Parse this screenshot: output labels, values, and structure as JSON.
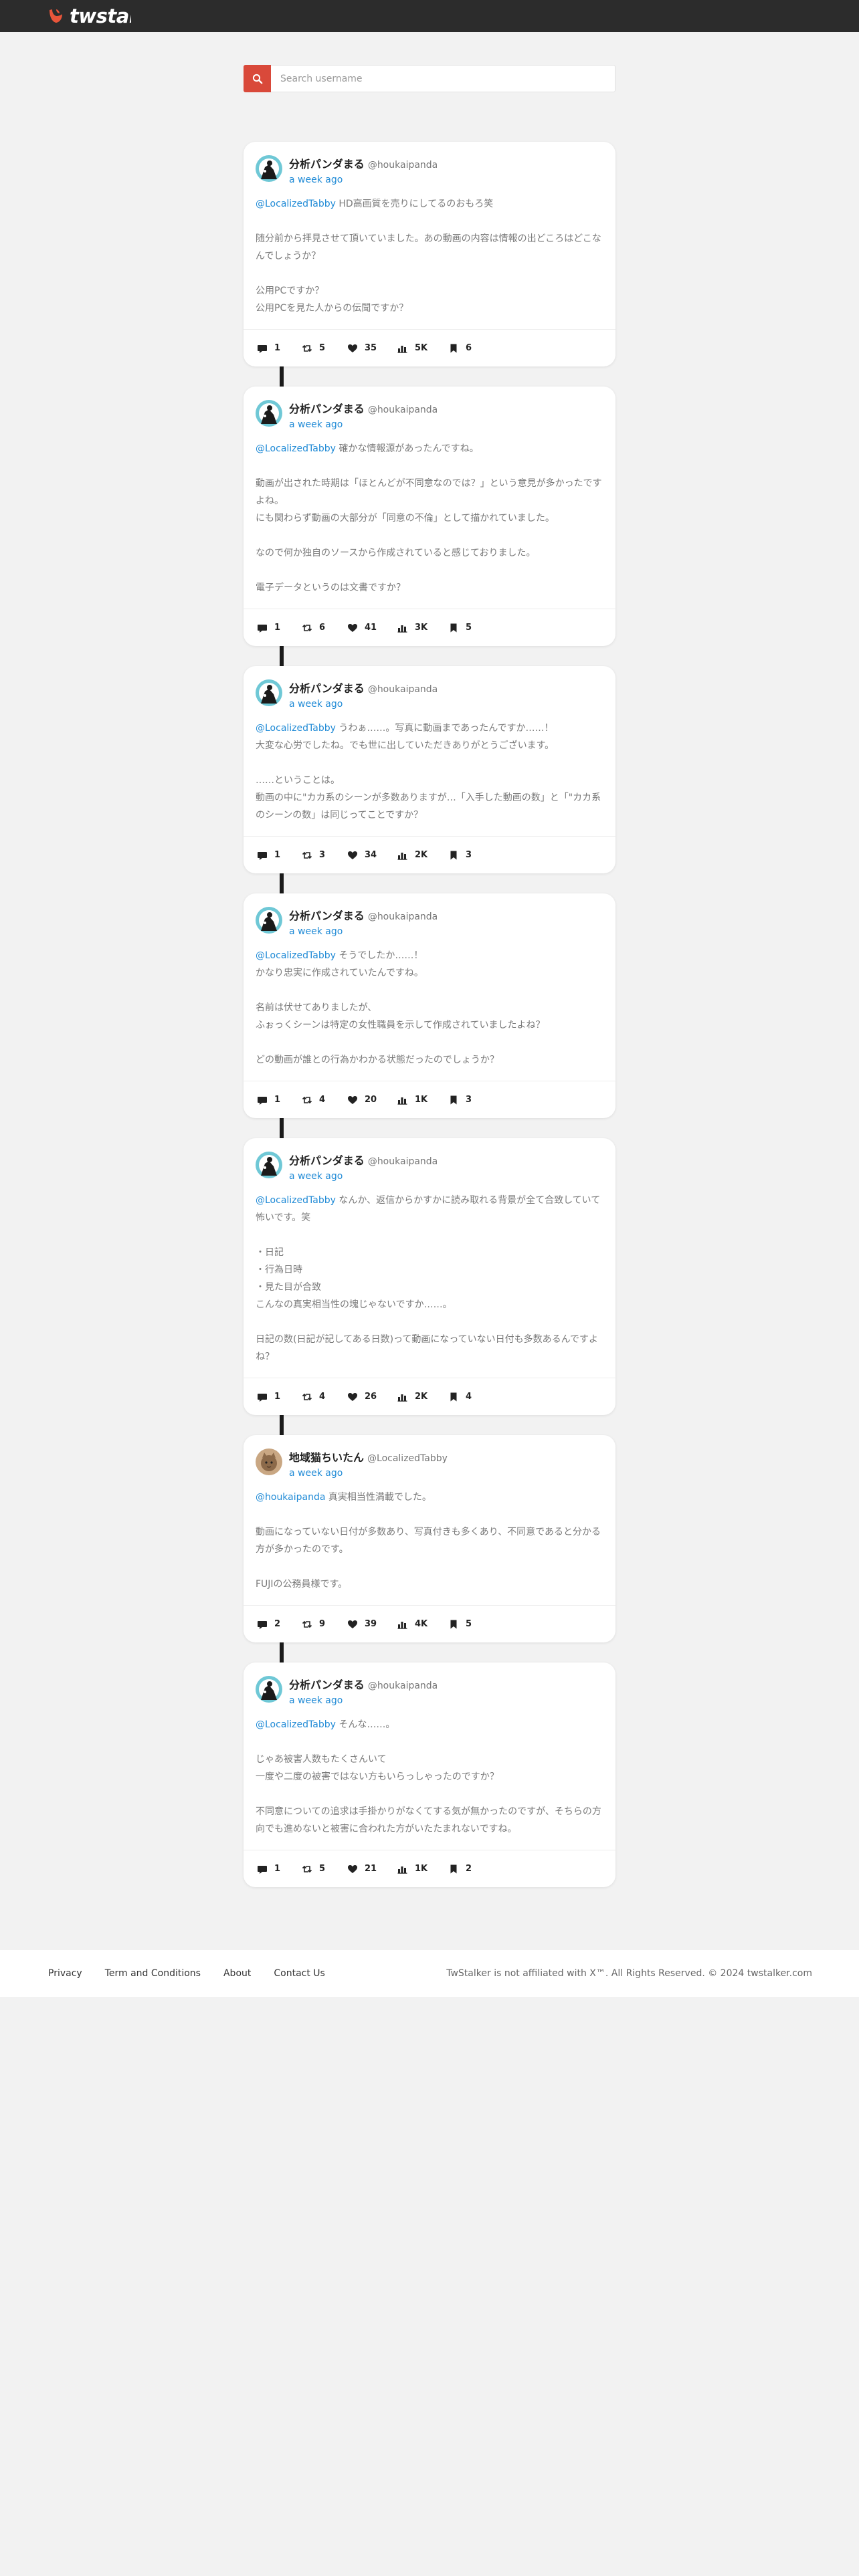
{
  "brand": {
    "name": "twstalker",
    "accent": "#e9553a"
  },
  "search": {
    "placeholder": "Search username",
    "value": ""
  },
  "posts": [
    {
      "avatar": "panda",
      "name": "分析パンダまる",
      "handle": "@houkaipanda",
      "time": "a week ago",
      "mention": "@LocalizedTabby",
      "text": " HD高画質を売りにしてるのおもろ笑\n\n随分前から拝見させて頂いていました。あの動画の内容は情報の出どころはどこなんでしょうか？\n\n公用PCですか？\n公用PCを見た人からの伝聞ですか？",
      "stats": {
        "replies": "1",
        "retweets": "5",
        "likes": "35",
        "views": "5K",
        "bookmarks": "6"
      }
    },
    {
      "avatar": "panda",
      "name": "分析パンダまる",
      "handle": "@houkaipanda",
      "time": "a week ago",
      "mention": "@LocalizedTabby",
      "text": " 確かな情報源があったんですね。\n\n動画が出された時期は「ほとんどが不同意なのでは？」という意見が多かったですよね。\nにも関わらず動画の大部分が「同意の不倫」として描かれていました。\n\nなので何か独自のソースから作成されていると感じておりました。\n\n電子データというのは文書ですか？",
      "stats": {
        "replies": "1",
        "retweets": "6",
        "likes": "41",
        "views": "3K",
        "bookmarks": "5"
      }
    },
    {
      "avatar": "panda",
      "name": "分析パンダまる",
      "handle": "@houkaipanda",
      "time": "a week ago",
      "mention": "@LocalizedTabby",
      "text": " うわぁ……。写真に動画まであったんですか……！\n大変な心労でしたね。でも世に出していただきありがとうございます。\n\n……ということは。\n動画の中に\"カカ系のシーンが多数ありますが…「入手した動画の数」と「\"カカ系のシーンの数」は同じってことですか？",
      "stats": {
        "replies": "1",
        "retweets": "3",
        "likes": "34",
        "views": "2K",
        "bookmarks": "3"
      }
    },
    {
      "avatar": "panda",
      "name": "分析パンダまる",
      "handle": "@houkaipanda",
      "time": "a week ago",
      "mention": "@LocalizedTabby",
      "text": " そうでしたか……！\nかなり忠実に作成されていたんですね。\n\n名前は伏せてありましたが、\nふぉっくシーンは特定の女性職員を示して作成されていましたよね？\n\nどの動画が誰との行為かわかる状態だったのでしょうか？",
      "stats": {
        "replies": "1",
        "retweets": "4",
        "likes": "20",
        "views": "1K",
        "bookmarks": "3"
      }
    },
    {
      "avatar": "panda",
      "name": "分析パンダまる",
      "handle": "@houkaipanda",
      "time": "a week ago",
      "mention": "@LocalizedTabby",
      "text": " なんか、返信からかすかに読み取れる背景が全て合致していて怖いです。笑\n\n・日記\n・行為日時\n・見た目が合致\nこんなの真実相当性の塊じゃないですか……。\n\n日記の数(日記が記してある日数)って動画になっていない日付も多数あるんですよね？",
      "stats": {
        "replies": "1",
        "retweets": "4",
        "likes": "26",
        "views": "2K",
        "bookmarks": "4"
      }
    },
    {
      "avatar": "tabby",
      "name": "地域猫ちいたん",
      "handle": "@LocalizedTabby",
      "time": "a week ago",
      "mention": "@houkaipanda",
      "text": " 真実相当性満載でした。\n\n動画になっていない日付が多数あり、写真付きも多くあり、不同意であると分かる方が多かったのです。\n\nFUJIの公務員様です。",
      "stats": {
        "replies": "2",
        "retweets": "9",
        "likes": "39",
        "views": "4K",
        "bookmarks": "5"
      }
    },
    {
      "avatar": "panda",
      "name": "分析パンダまる",
      "handle": "@houkaipanda",
      "time": "a week ago",
      "mention": "@LocalizedTabby",
      "text": " そんな……。\n\nじゃあ被害人数もたくさんいて\n一度や二度の被害ではない方もいらっしゃったのですか？\n\n不同意についての追求は手掛かりがなくてする気が無かったのですが、そちらの方向でも進めないと被害に合われた方がいたたまれないですね。",
      "stats": {
        "replies": "1",
        "retweets": "5",
        "likes": "21",
        "views": "1K",
        "bookmarks": "2"
      }
    }
  ],
  "footer": {
    "links": [
      "Privacy",
      "Term and Conditions",
      "About",
      "Contact Us"
    ],
    "copyright": "TwStalker is not affiliated with X™. All Rights Reserved. © 2024 twstalker.com"
  }
}
